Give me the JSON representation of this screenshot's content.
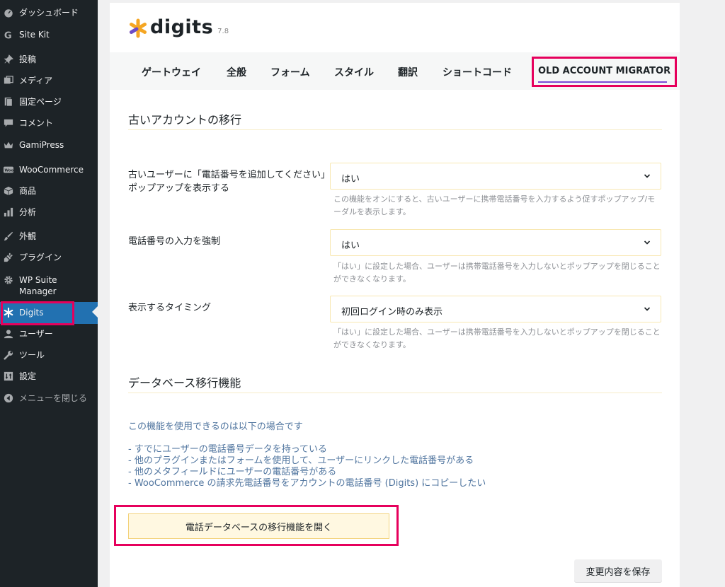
{
  "sidebar": {
    "items": [
      {
        "label": "ダッシュボード",
        "icon": "dashboard-icon"
      },
      {
        "label": "Site Kit",
        "icon": "google-g-icon"
      },
      {
        "label": "投稿",
        "icon": "pushpin-icon"
      },
      {
        "label": "メディア",
        "icon": "media-icon"
      },
      {
        "label": "固定ページ",
        "icon": "page-icon"
      },
      {
        "label": "コメント",
        "icon": "comment-icon"
      },
      {
        "label": "GamiPress",
        "icon": "crown-icon"
      },
      {
        "label": "WooCommerce",
        "icon": "woo-icon"
      },
      {
        "label": "商品",
        "icon": "box-icon"
      },
      {
        "label": "分析",
        "icon": "bar-chart-icon"
      },
      {
        "label": "外観",
        "icon": "brush-icon"
      },
      {
        "label": "プラグイン",
        "icon": "plug-icon"
      },
      {
        "label": "WP Suite Manager",
        "icon": "gear-icon"
      },
      {
        "label": "Digits",
        "icon": "asterisk-icon"
      },
      {
        "label": "ユーザー",
        "icon": "user-icon"
      },
      {
        "label": "ツール",
        "icon": "wrench-icon"
      },
      {
        "label": "設定",
        "icon": "settings-icon"
      },
      {
        "label": "メニューを閉じる",
        "icon": "collapse-icon"
      }
    ]
  },
  "header": {
    "logo_text": "digits",
    "version": "7.8"
  },
  "tabs": [
    {
      "label": "ゲートウェイ"
    },
    {
      "label": "全般"
    },
    {
      "label": "フォーム"
    },
    {
      "label": "スタイル"
    },
    {
      "label": "翻訳"
    },
    {
      "label": "ショートコード"
    },
    {
      "label": "OLD ACCOUNT MIGRATOR"
    }
  ],
  "section1": {
    "title": "古いアカウントの移行",
    "rows": [
      {
        "label": "古いユーザーに「電話番号を追加してください」ポップアップを表示する",
        "value": "はい",
        "help": "この機能をオンにすると、古いユーザーに携帯電話番号を入力するよう促すポップアップ/モーダルを表示します。"
      },
      {
        "label": "電話番号の入力を強制",
        "value": "はい",
        "help": "「はい」に設定した場合、ユーザーは携帯電話番号を入力しないとポップアップを閉じることができなくなります。"
      },
      {
        "label": "表示するタイミング",
        "value": "初回ログイン時のみ表示",
        "help": "「はい」に設定した場合、ユーザーは携帯電話番号を入力しないとポップアップを閉じることができなくなります。"
      }
    ]
  },
  "section2": {
    "title": "データベース移行機能",
    "intro": "この機能を使用できるのは以下の場合です",
    "list": [
      "- すでにユーザーの電話番号データを持っている",
      "- 他のプラグインまたはフォームを使用して、ユーザーにリンクした電話番号がある",
      "- 他のメタフィールドにユーザーの電話番号がある",
      "- WooCommerce の請求先電話番号をアカウントの電話番号 (Digits) にコピーしたい"
    ],
    "button": "電話データベースの移行機能を開く"
  },
  "footer": {
    "save": "変更内容を保存"
  },
  "colors": {
    "sidebar_bg": "#1d2327",
    "active_bg": "#2271b1",
    "highlight": "#e6005c",
    "tab_underline": "#7b4bd6",
    "logo_orange": "#f5a623"
  }
}
